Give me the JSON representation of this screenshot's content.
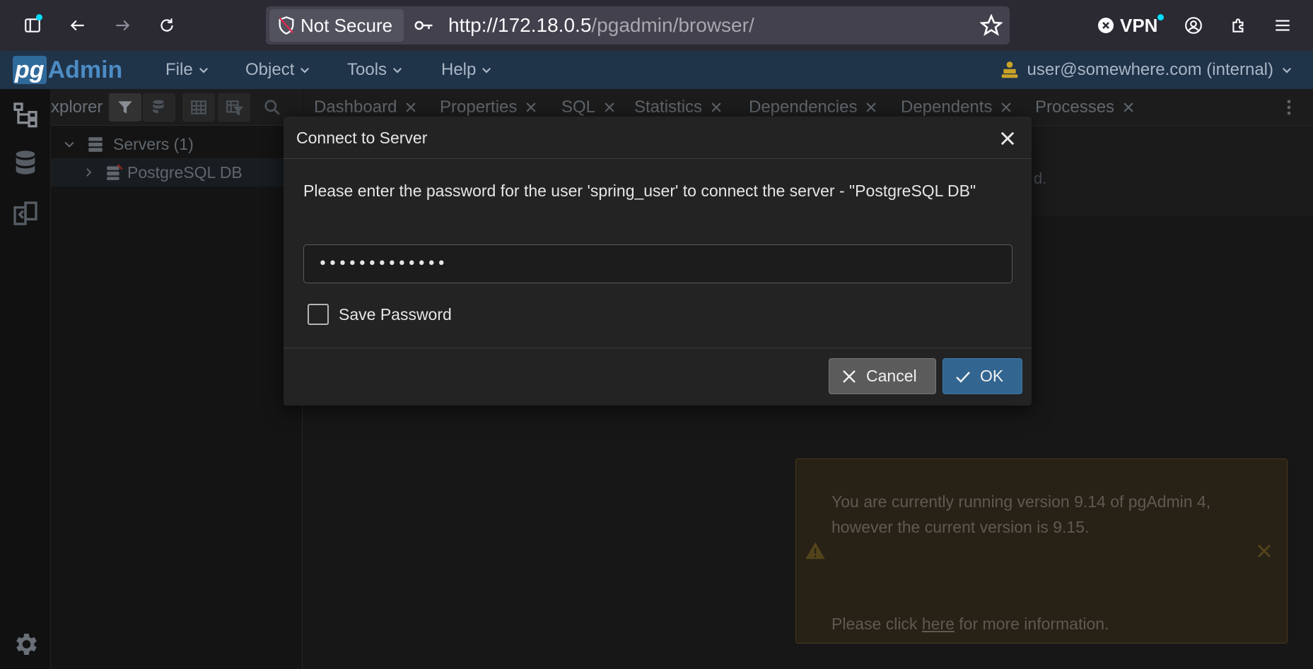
{
  "browser": {
    "security_label": "Not Secure",
    "url_host": "http://172.18.0.5",
    "url_path": "/pgadmin/browser/",
    "vpn_label": "VPN"
  },
  "pgadmin": {
    "logo_pg": "pg",
    "logo_admin": "Admin",
    "menu": [
      {
        "label": "File"
      },
      {
        "label": "Object"
      },
      {
        "label": "Tools"
      },
      {
        "label": "Help"
      }
    ],
    "user": "user@somewhere.com (internal)"
  },
  "explorer": {
    "title": "xplorer",
    "tree": [
      {
        "label": "Servers (1)"
      },
      {
        "label": "PostgreSQL DB"
      }
    ]
  },
  "tabs": [
    {
      "label": "Dashboard"
    },
    {
      "label": "Properties"
    },
    {
      "label": "SQL"
    },
    {
      "label": "Statistics"
    },
    {
      "label": "Dependencies"
    },
    {
      "label": "Dependents"
    },
    {
      "label": "Processes"
    }
  ],
  "main": {
    "banner_tail": "d."
  },
  "notice": {
    "message": "You are currently running version 9.14 of pgAdmin 4, however the current version is 9.15.",
    "more_prefix": "Please click ",
    "more_link": "here",
    "more_suffix": " for more information."
  },
  "dialog": {
    "title": "Connect to Server",
    "message": "Please enter the password for the user 'spring_user' to connect the server - \"PostgreSQL DB\"",
    "password_value": "•••••••••••••",
    "save_password_label": "Save Password",
    "save_password_checked": false,
    "cancel_label": "Cancel",
    "ok_label": "OK"
  },
  "colors": {
    "accent": "#326690",
    "header_bg": "#1f3349",
    "notice_bg": "#3a3121"
  }
}
